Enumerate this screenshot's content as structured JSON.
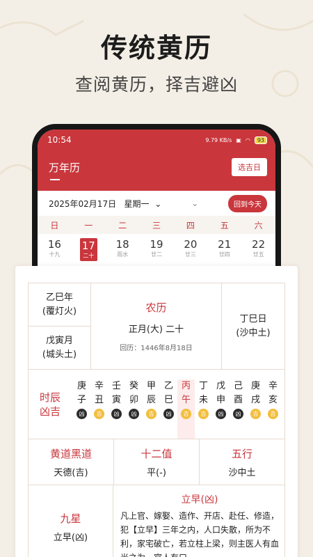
{
  "promo": {
    "headline": "传统黄历",
    "subline": "查阅黄历，择吉避凶"
  },
  "status_bar": {
    "time": "10:54",
    "net_speed": "9.79 KB/s",
    "battery": "93"
  },
  "header": {
    "title": "万年历",
    "select_button": "选吉日"
  },
  "date_bar": {
    "date": "2025年02月17日",
    "weekday": "星期一",
    "today_button": "回到今天"
  },
  "week": {
    "headers": [
      "日",
      "一",
      "二",
      "三",
      "四",
      "五",
      "六"
    ],
    "days": [
      {
        "num": "16",
        "lunar": "十九"
      },
      {
        "num": "17",
        "lunar": "二十"
      },
      {
        "num": "18",
        "lunar": "雨水"
      },
      {
        "num": "19",
        "lunar": "廿二"
      },
      {
        "num": "20",
        "lunar": "廿三"
      },
      {
        "num": "21",
        "lunar": "廿四"
      },
      {
        "num": "22",
        "lunar": "廿五"
      }
    ]
  },
  "almanac": {
    "year": "乙巳年",
    "year_element": "(覆灯火)",
    "month": "戊寅月",
    "month_element": "(城头土)",
    "lunar_label": "农历",
    "lunar_date": "正月(大) 二十",
    "hui_calendar": "回历：1446年8月18日",
    "day": "丁巳日",
    "day_element": "(沙中土)",
    "hours_label_1": "时辰",
    "hours_label_2": "凶吉",
    "hours": [
      {
        "stem": "庚",
        "branch": "子",
        "luck": "凶"
      },
      {
        "stem": "辛",
        "branch": "丑",
        "luck": "吉"
      },
      {
        "stem": "壬",
        "branch": "寅",
        "luck": "凶"
      },
      {
        "stem": "癸",
        "branch": "卯",
        "luck": "凶"
      },
      {
        "stem": "甲",
        "branch": "辰",
        "luck": "吉"
      },
      {
        "stem": "乙",
        "branch": "巳",
        "luck": "凶"
      },
      {
        "stem": "丙",
        "branch": "午",
        "luck": "吉"
      },
      {
        "stem": "丁",
        "branch": "未",
        "luck": "吉"
      },
      {
        "stem": "戊",
        "branch": "申",
        "luck": "凶"
      },
      {
        "stem": "己",
        "branch": "酉",
        "luck": "凶"
      },
      {
        "stem": "庚",
        "branch": "戌",
        "luck": "吉"
      },
      {
        "stem": "辛",
        "branch": "亥",
        "luck": "吉"
      }
    ],
    "huangdao_label": "黄道黑道",
    "huangdao_value": "天德(吉)",
    "zhi_label": "十二值",
    "zhi_value": "平(-)",
    "wuxing_label": "五行",
    "wuxing_value": "沙中土",
    "star_label": "九星",
    "star_value": "立早(凶)",
    "star_detail_title": "立早(凶)",
    "star_detail_text": "凡上官、嫁娶、造作、开店、赴任、修造，犯【立早】三年之内，人口失散，所为不利，家宅破亡，若立柱上梁，则主医人有血光之为，官人有口"
  },
  "colors": {
    "accent": "#c9363c",
    "good": "#f2be3d",
    "bad": "#2c2c2c"
  }
}
